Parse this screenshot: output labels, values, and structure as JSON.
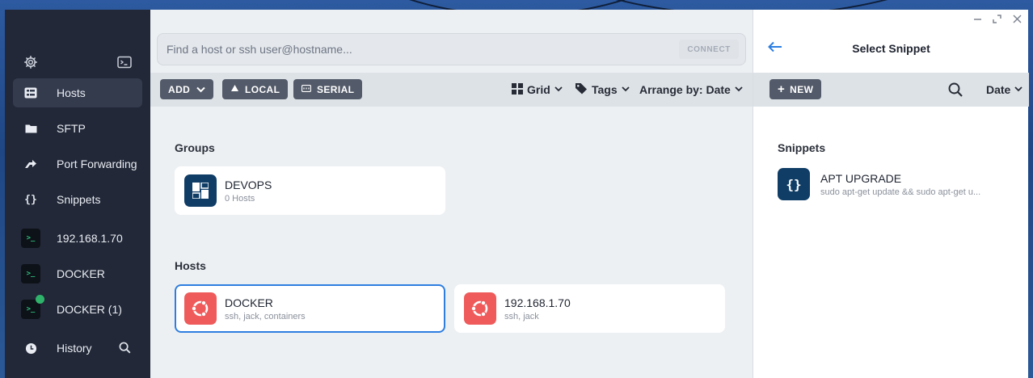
{
  "colors": {
    "sidebar_bg": "#222838",
    "accent_blue": "#2d7ee0",
    "ubuntu_orange": "#ef5b5b",
    "group_badge": "#0f3d66",
    "online_green": "#2fb36b",
    "button_dark": "#535a69"
  },
  "sidebar": {
    "top_icons": [
      "gear-icon",
      "terminal-icon"
    ],
    "items": [
      {
        "label": "Hosts",
        "icon": "hosts-grid-icon",
        "active": true
      },
      {
        "label": "SFTP",
        "icon": "folder-icon",
        "active": false
      },
      {
        "label": "Port Forwarding",
        "icon": "port-forward-arrow-icon",
        "active": false
      },
      {
        "label": "Snippets",
        "icon": "curly-braces-icon",
        "active": false
      },
      {
        "label": "192.168.1.70",
        "icon": "terminal-session-icon",
        "active": false
      },
      {
        "label": "DOCKER",
        "icon": "terminal-session-icon",
        "active": false
      },
      {
        "label": "DOCKER (1)",
        "icon": "terminal-session-icon",
        "active": false,
        "online": true
      },
      {
        "label": "History",
        "icon": "clock-icon",
        "active": false
      }
    ],
    "history_search_icon": "search-icon"
  },
  "main": {
    "search": {
      "placeholder": "Find a host or ssh user@hostname...",
      "value": ""
    },
    "connect_label": "CONNECT",
    "toolbar": {
      "add_label": "ADD",
      "local_label": "LOCAL",
      "serial_label": "SERIAL",
      "view_label": "Grid",
      "tags_label": "Tags",
      "arrange_label": "Arrange by: Date"
    },
    "groups_title": "Groups",
    "groups": [
      {
        "name": "DEVOPS",
        "subtitle": "0 Hosts"
      }
    ],
    "hosts_title": "Hosts",
    "hosts": [
      {
        "name": "DOCKER",
        "subtitle": "ssh, jack, containers",
        "selected": true
      },
      {
        "name": "192.168.1.70",
        "subtitle": "ssh, jack",
        "selected": false
      }
    ]
  },
  "panel": {
    "title": "Select Snippet",
    "new_label": "NEW",
    "sort_label": "Date",
    "section_title": "Snippets",
    "snippets": [
      {
        "name": "APT UPGRADE",
        "command": "sudo apt-get update && sudo apt-get u..."
      }
    ],
    "window_controls": [
      "minimize-icon",
      "maximize-icon",
      "close-icon"
    ]
  }
}
